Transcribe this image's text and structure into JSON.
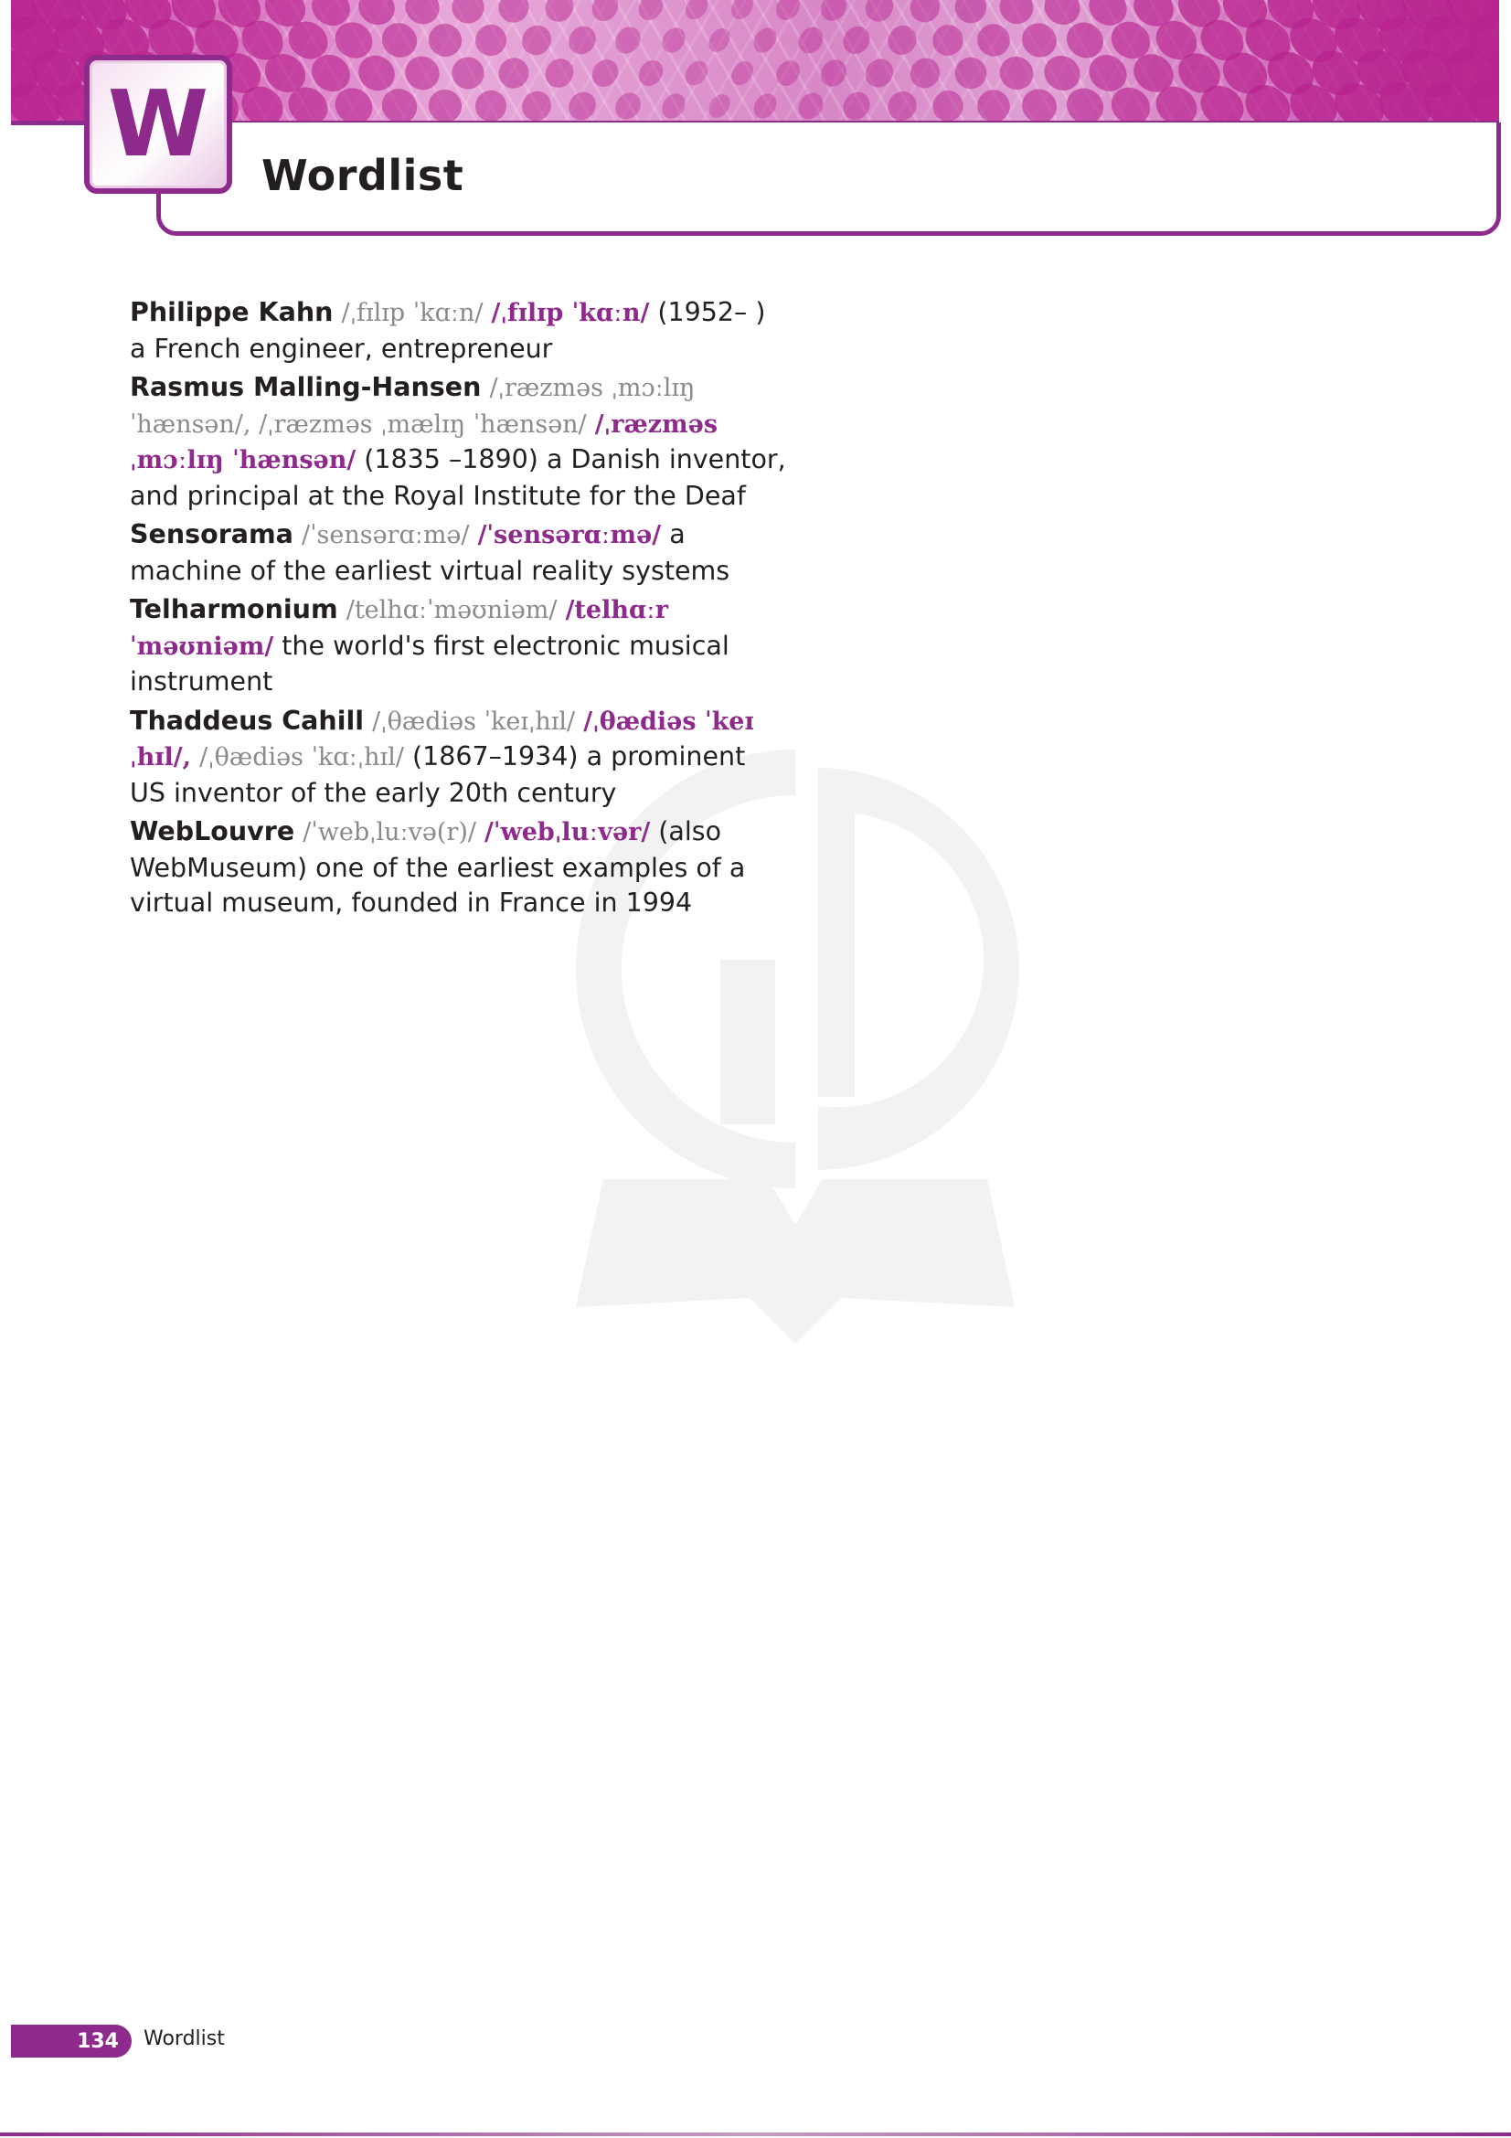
{
  "header": {
    "letter": "W",
    "title": "Wordlist"
  },
  "colors": {
    "accent": "#8e2a8b",
    "banner_light": "#e7a9d9",
    "pronunciation_grey": "#8a8a8a"
  },
  "icons": {
    "banner": "pink-dot-pattern-banner",
    "watermark": "gd-book-logo-watermark"
  },
  "entries": [
    {
      "headword": "Philippe Kahn",
      "ipa_br": "/ˌfɪlɪp ˈkɑːn/",
      "ipa_am": "/ˌfɪlɪp ˈkɑːn/",
      "definition": " (1952– ) a French engineer, entrepreneur"
    },
    {
      "headword": "Rasmus Malling-Hansen",
      "ipa_br": "/ˌræzməs ˌmɔːlɪŋ ˈhænsən/, /ˌræzməs ˌmælɪŋ ˈhænsən/",
      "ipa_am": "/ˌræzməs ˌmɔːlɪŋ ˈhænsən/",
      "definition": " (1835 –1890) a Danish inventor, and principal at the Royal Institute for the Deaf"
    },
    {
      "headword": "Sensorama",
      "ipa_br": "/ˈsensərɑːmə/",
      "ipa_am": "/ˈsensərɑːmə/",
      "definition": " a machine of the earliest virtual reality systems"
    },
    {
      "headword": "Telharmonium",
      "ipa_br": "/telhɑːˈməʊniəm/",
      "ipa_am": "/telhɑːrˈməʊniəm/",
      "definition": " the world's first electronic musical instrument"
    },
    {
      "headword": "Thaddeus Cahill",
      "ipa_br": "/ˌθædiəs ˈkeɪˌhɪl/",
      "ipa_am": "/ˌθædiəs ˈkeɪˌhɪl/,",
      "ipa_br2": "/ˌθædiəs ˈkɑːˌhɪl/",
      "definition": " (1867–1934) a prominent US inventor of the early 20th century"
    },
    {
      "headword": "WebLouvre",
      "ipa_br": "/ˈwebˌluːvə(r)/",
      "ipa_am": "/ˈwebˌluːvər/",
      "definition": " (also WebMuseum) one of the earliest examples of a virtual museum, founded in France in 1994"
    }
  ],
  "footer": {
    "page_number": "134",
    "label": "Wordlist"
  }
}
